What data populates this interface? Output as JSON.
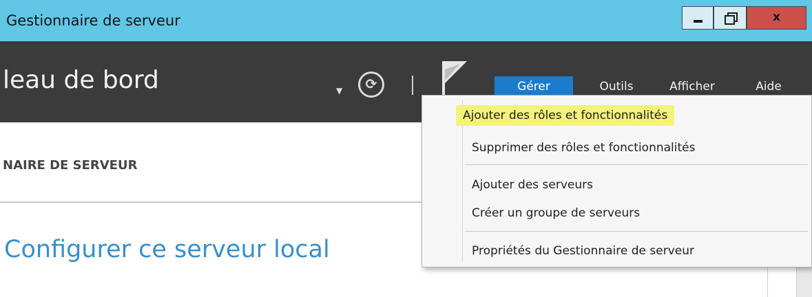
{
  "window": {
    "title": "Gestionnaire de serveur",
    "close_label": "x"
  },
  "toolbar": {
    "page_title": "leau de bord",
    "menu": {
      "gerer": "Gérer",
      "outils": "Outils",
      "afficher": "Afficher",
      "aide": "Aide"
    }
  },
  "subheader": {
    "section_title": "NAIRE DE SERVEUR"
  },
  "main": {
    "heading": "Configurer ce serveur local"
  },
  "dropdown": {
    "items": [
      "Ajouter des rôles et fonctionnalités",
      "Supprimer des rôles et fonctionnalités",
      "Ajouter des serveurs",
      "Créer un groupe de serveurs",
      "Propriétés du Gestionnaire de serveur"
    ],
    "highlighted_index": 0
  },
  "colors": {
    "titlebar": "#62c6e6",
    "toolbar": "#3b3b3b",
    "menu_active": "#1c7ccb",
    "highlight": "#f4f279",
    "heading": "#3a8ec9",
    "close_button": "#c9514a"
  },
  "icons": {
    "minimize": "minimize-icon",
    "maximize": "restore-icon",
    "close": "close-icon",
    "refresh": "refresh-icon",
    "flag": "flag-icon",
    "dropdown_arrow": "chevron-down-icon"
  }
}
